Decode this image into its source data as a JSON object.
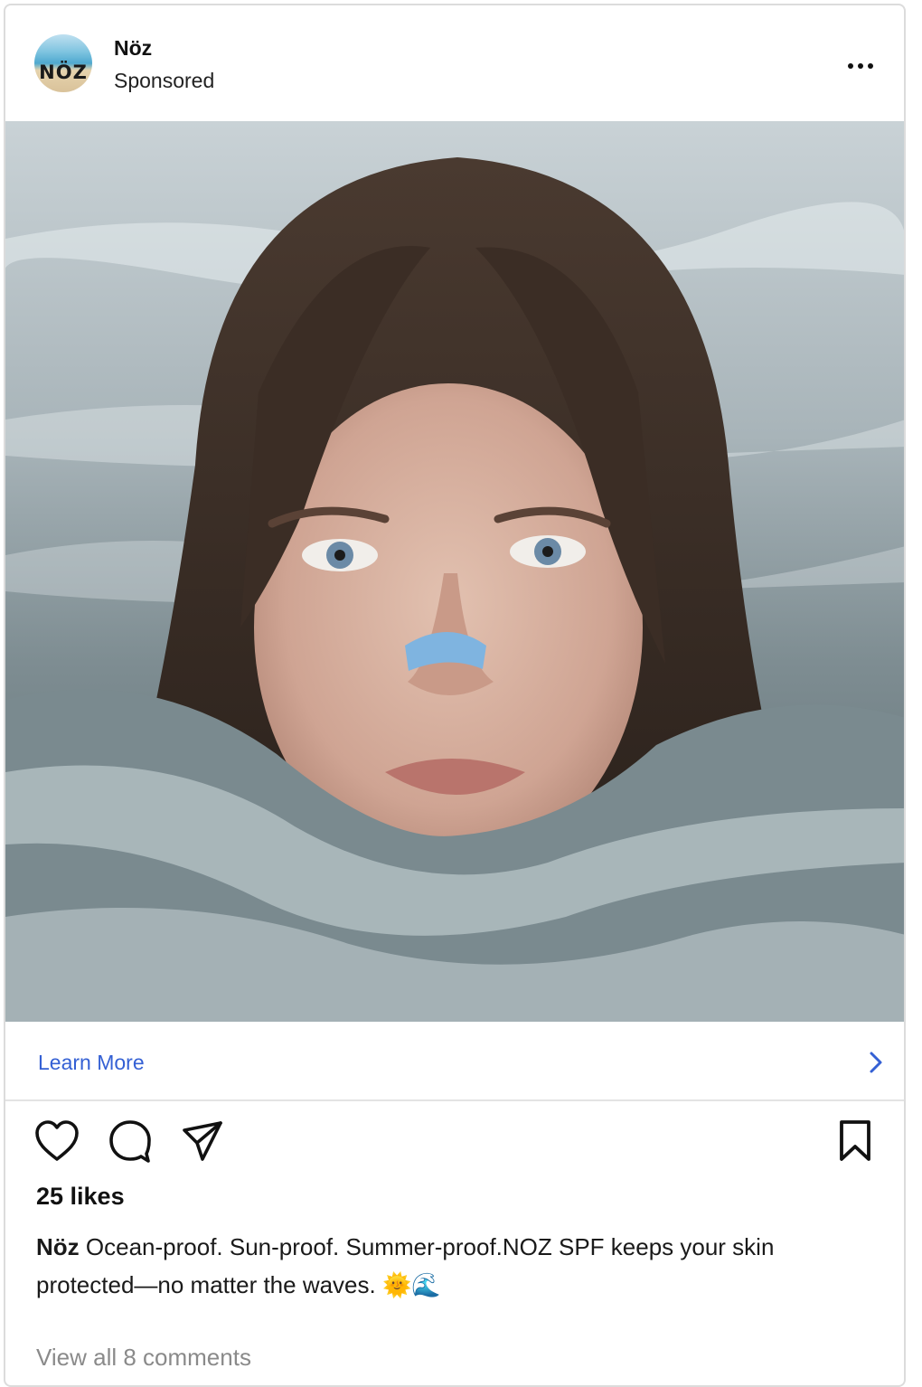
{
  "post": {
    "account_name": "Nöz",
    "sponsored_label": "Sponsored",
    "avatar_text": "NÖZ",
    "image_subject": "ad photo",
    "cta_label": "Learn More",
    "likes_text": "25 likes",
    "caption_user": "Nöz",
    "caption_text": "Ocean-proof. Sun-proof. Summer-proof.NOZ SPF keeps your skin protected—no matter the waves. 🌞🌊",
    "view_comments_text": "View all 8 comments"
  },
  "icons": {
    "more": "more-horizontal-icon",
    "like": "heart-icon",
    "comment": "comment-bubble-icon",
    "share": "paper-plane-icon",
    "save": "bookmark-icon",
    "cta": "chevron-right-icon"
  },
  "colors": {
    "cta_text": "#3460d4",
    "muted_text": "#8a8a8a",
    "border": "#dcdcdc"
  }
}
